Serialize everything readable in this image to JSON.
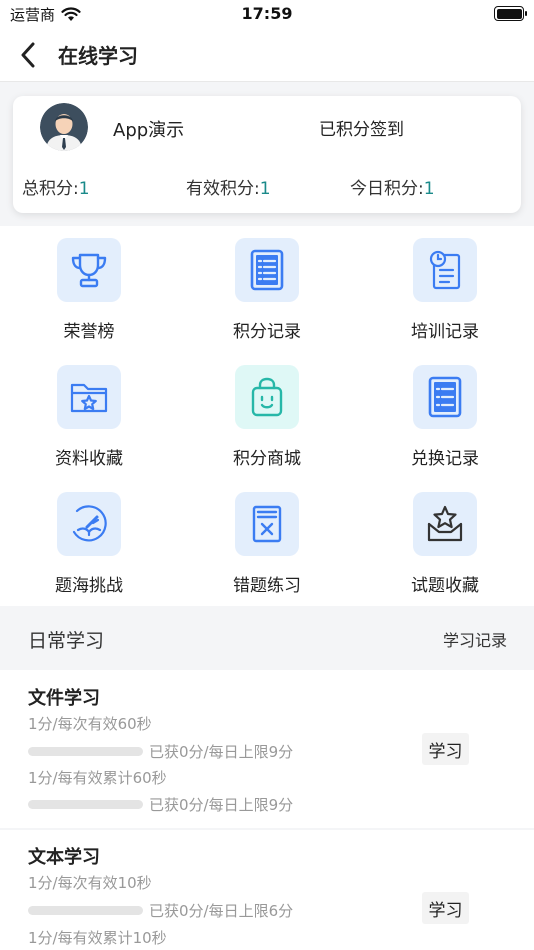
{
  "status_bar": {
    "carrier": "运营商",
    "time": "17:59"
  },
  "nav": {
    "title": "在线学习"
  },
  "profile": {
    "name": "App演示",
    "signin": "已积分签到",
    "stats": [
      {
        "label": "总积分:",
        "value": "1"
      },
      {
        "label": "有效积分:",
        "value": "1"
      },
      {
        "label": "今日积分:",
        "value": "1"
      }
    ]
  },
  "grid": [
    {
      "label": "荣誉榜",
      "icon": "trophy-icon"
    },
    {
      "label": "积分记录",
      "icon": "list-document-icon"
    },
    {
      "label": "培训记录",
      "icon": "clock-document-icon"
    },
    {
      "label": "资料收藏",
      "icon": "star-folder-icon"
    },
    {
      "label": "积分商城",
      "icon": "shopping-bag-icon"
    },
    {
      "label": "兑换记录",
      "icon": "exchange-list-icon"
    },
    {
      "label": "题海挑战",
      "icon": "book-challenge-icon"
    },
    {
      "label": "错题练习",
      "icon": "wrong-question-icon"
    },
    {
      "label": "试题收藏",
      "icon": "star-inbox-icon"
    }
  ],
  "daily": {
    "title": "日常学习",
    "link": "学习记录"
  },
  "studies": [
    {
      "title": "文件学习",
      "rule1": "1分/每次有效60秒",
      "progress1": {
        "text": "已获0分/每日上限9分",
        "fraction": 0
      },
      "rule2": "1分/每有效累计60秒",
      "progress2": {
        "text": "已获0分/每日上限9分",
        "fraction": 0
      },
      "button": "学习"
    },
    {
      "title": "文本学习",
      "rule1": "1分/每次有效10秒",
      "progress1": {
        "text": "已获0分/每日上限6分",
        "fraction": 0
      },
      "rule2": "1分/每有效累计10秒",
      "button": "学习"
    }
  ],
  "colors": {
    "accent": "#3b7cf2",
    "stat_value": "#1a8a8a",
    "icon_bg_blue": "#e3eefc",
    "icon_bg_cyan": "#dff8f6",
    "icon_cyan": "#26b7a8"
  }
}
